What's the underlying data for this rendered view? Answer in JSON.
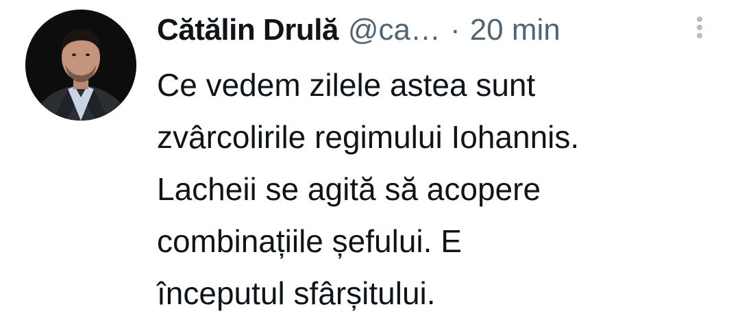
{
  "tweet": {
    "author": {
      "display_name": "Cătălin Drulă",
      "handle": "@ca…",
      "avatar_icon": "profile-photo"
    },
    "separator": "·",
    "timestamp": "20 min",
    "more_icon": "more-options-vertical-icon",
    "text_lines": [
      "Ce vedem zilele astea sunt",
      "zvârcolirile regimului Iohannis.",
      "Lacheii se agită să acopere",
      "combinațiile șefului. E",
      "începutul sfârșitului."
    ]
  },
  "colors": {
    "text_primary": "#0f1419",
    "text_secondary": "#536471",
    "icon_muted": "#b4bcc4",
    "background": "#ffffff"
  }
}
